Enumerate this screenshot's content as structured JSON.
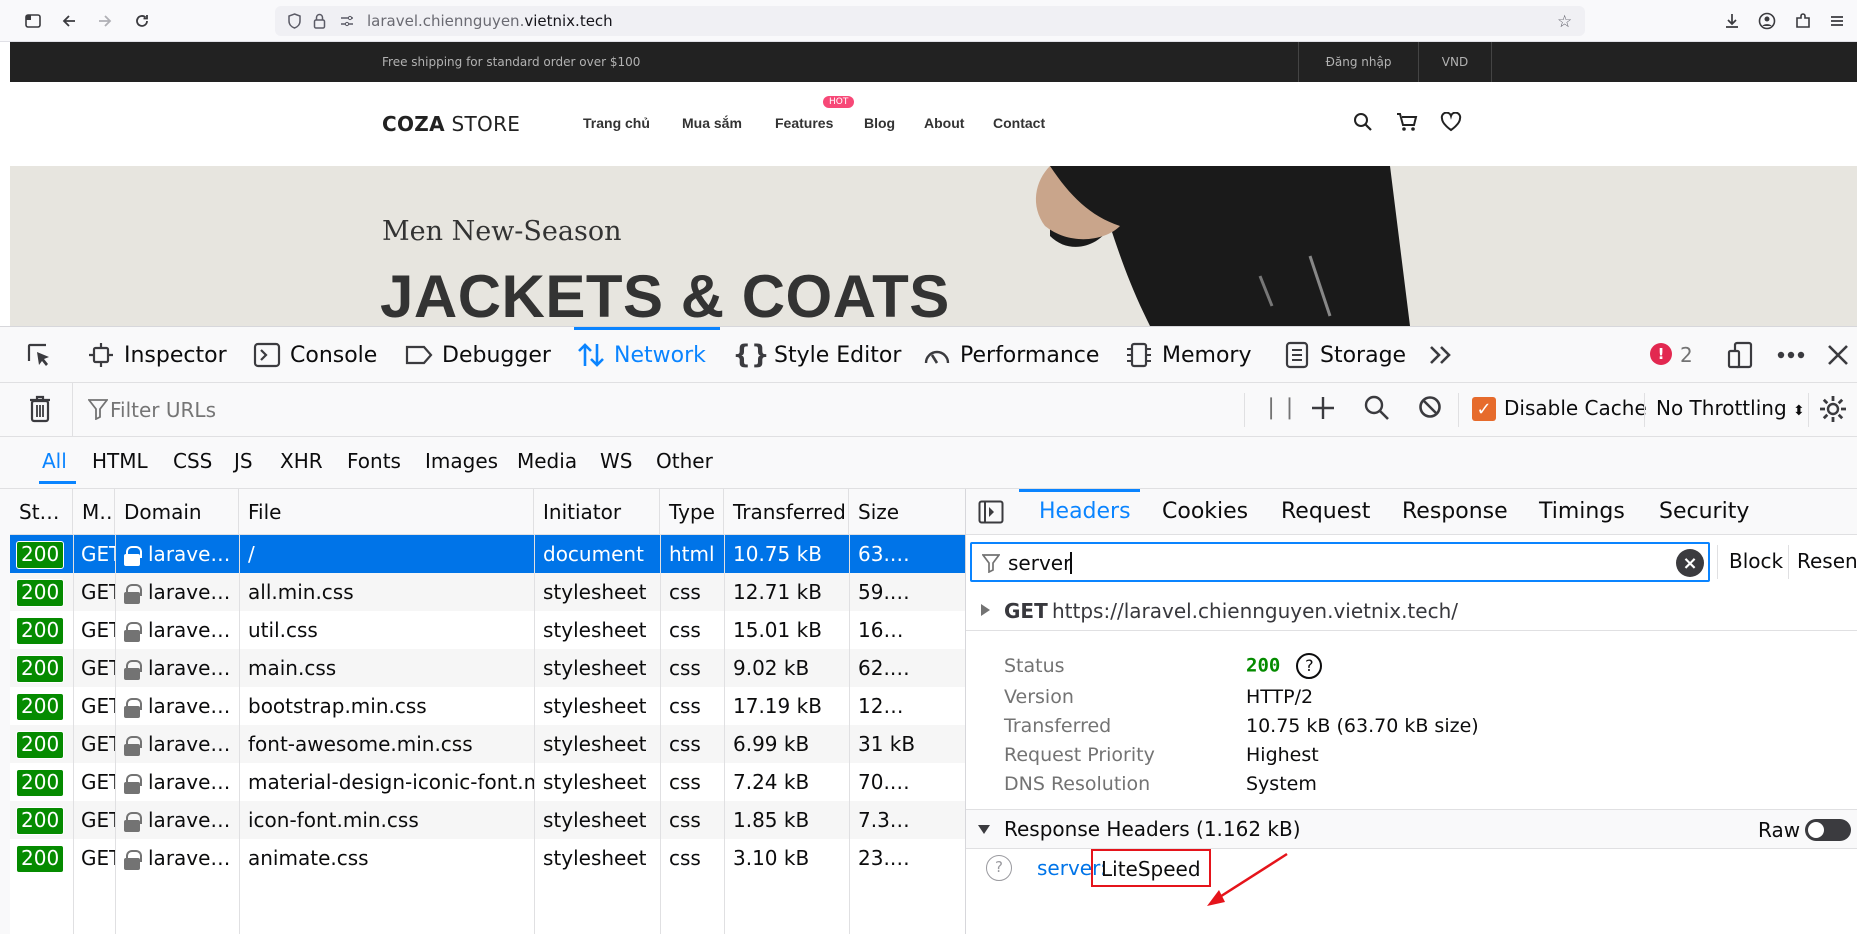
{
  "browser": {
    "url_prefix": "laravel.chiennguyen.",
    "url_domain": "vietnix.tech"
  },
  "site": {
    "shipping_text": "Free shipping for standard order over $100",
    "login": "Đăng nhập",
    "currency": "VND",
    "logo_bold": "COZA",
    "logo_rest": " STORE",
    "nav": [
      "Trang chủ",
      "Mua sắm",
      "Features",
      "Blog",
      "About",
      "Contact"
    ],
    "hot_badge": "HOT",
    "hero_subtitle": "Men New-Season",
    "hero_title": "JACKETS & COATS"
  },
  "devtools": {
    "tools": [
      "Inspector",
      "Console",
      "Debugger",
      "Network",
      "Style Editor",
      "Performance",
      "Memory",
      "Storage"
    ],
    "error_count": "2",
    "filter_placeholder": "Filter URLs",
    "disable_cache": "Disable Cache",
    "throttling": "No Throttling",
    "type_filters": [
      "All",
      "HTML",
      "CSS",
      "JS",
      "XHR",
      "Fonts",
      "Images",
      "Media",
      "WS",
      "Other"
    ],
    "columns": [
      "St…",
      "M…",
      "Domain",
      "File",
      "Initiator",
      "Type",
      "Transferred",
      "Size"
    ],
    "requests": [
      {
        "status": "200",
        "method": "GET",
        "domain": "larave…",
        "file": "/",
        "initiator": "document",
        "type": "html",
        "transferred": "10.75 kB",
        "size": "63.…"
      },
      {
        "status": "200",
        "method": "GET",
        "domain": "larave…",
        "file": "all.min.css",
        "initiator": "stylesheet",
        "type": "css",
        "transferred": "12.71 kB",
        "size": "59.…"
      },
      {
        "status": "200",
        "method": "GET",
        "domain": "larave…",
        "file": "util.css",
        "initiator": "stylesheet",
        "type": "css",
        "transferred": "15.01 kB",
        "size": "16…"
      },
      {
        "status": "200",
        "method": "GET",
        "domain": "larave…",
        "file": "main.css",
        "initiator": "stylesheet",
        "type": "css",
        "transferred": "9.02 kB",
        "size": "62.…"
      },
      {
        "status": "200",
        "method": "GET",
        "domain": "larave…",
        "file": "bootstrap.min.css",
        "initiator": "stylesheet",
        "type": "css",
        "transferred": "17.19 kB",
        "size": "12…"
      },
      {
        "status": "200",
        "method": "GET",
        "domain": "larave…",
        "file": "font-awesome.min.css",
        "initiator": "stylesheet",
        "type": "css",
        "transferred": "6.99 kB",
        "size": "31 kB"
      },
      {
        "status": "200",
        "method": "GET",
        "domain": "larave…",
        "file": "material-design-iconic-font.min.css",
        "initiator": "stylesheet",
        "type": "css",
        "transferred": "7.24 kB",
        "size": "70.…"
      },
      {
        "status": "200",
        "method": "GET",
        "domain": "larave…",
        "file": "icon-font.min.css",
        "initiator": "stylesheet",
        "type": "css",
        "transferred": "1.85 kB",
        "size": "7.3…"
      },
      {
        "status": "200",
        "method": "GET",
        "domain": "larave…",
        "file": "animate.css",
        "initiator": "stylesheet",
        "type": "css",
        "transferred": "3.10 kB",
        "size": "23.…"
      }
    ],
    "side_tabs": [
      "Headers",
      "Cookies",
      "Request",
      "Response",
      "Timings",
      "Security"
    ],
    "header_filter_value": "server",
    "block_label": "Block",
    "resend_label": "Resend",
    "request_method": "GET",
    "request_url": "https://laravel.chiennguyen.vietnix.tech/",
    "summary": [
      {
        "key": "Status",
        "value": "200"
      },
      {
        "key": "Version",
        "value": "HTTP/2"
      },
      {
        "key": "Transferred",
        "value": "10.75 kB (63.70 kB size)"
      },
      {
        "key": "Request Priority",
        "value": "Highest"
      },
      {
        "key": "DNS Resolution",
        "value": "System"
      }
    ],
    "response_headers_title": "Response Headers (1.162 kB)",
    "raw_label": "Raw",
    "header_name": "server:",
    "header_value": "LiteSpeed"
  },
  "colors": {
    "accent": "#0a84ff",
    "status_ok": "#058b00",
    "highlight": "#e5141b"
  }
}
